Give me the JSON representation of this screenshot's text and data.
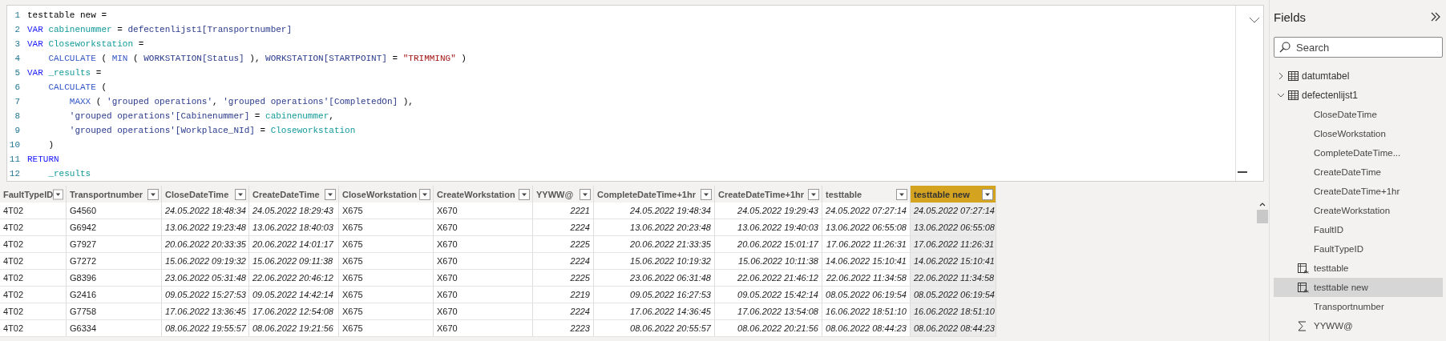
{
  "editor": {
    "lines": [
      {
        "number": "1",
        "tokens": [
          {
            "kind": "plain",
            "text": "testtable new ="
          }
        ]
      },
      {
        "number": "2",
        "tokens": [
          {
            "kind": "keyword",
            "text": "VAR "
          },
          {
            "kind": "variable",
            "text": "cabinenummer"
          },
          {
            "kind": "plain",
            "text": " = "
          },
          {
            "kind": "ref",
            "text": "defectenlijst1[Transportnumber]"
          }
        ]
      },
      {
        "number": "3",
        "tokens": [
          {
            "kind": "keyword",
            "text": "VAR "
          },
          {
            "kind": "variable",
            "text": "Closeworkstation"
          },
          {
            "kind": "plain",
            "text": " ="
          }
        ]
      },
      {
        "number": "4",
        "tokens": [
          {
            "kind": "function",
            "text": "    CALCULATE"
          },
          {
            "kind": "plain",
            "text": " ( "
          },
          {
            "kind": "function",
            "text": "MIN"
          },
          {
            "kind": "plain",
            "text": " ( "
          },
          {
            "kind": "ref",
            "text": "WORKSTATION[Status]"
          },
          {
            "kind": "plain",
            "text": " ), "
          },
          {
            "kind": "ref",
            "text": "WORKSTATION[STARTPOINT]"
          },
          {
            "kind": "plain",
            "text": " = "
          },
          {
            "kind": "string",
            "text": "\"TRIMMING\""
          },
          {
            "kind": "plain",
            "text": " )"
          }
        ]
      },
      {
        "number": "5",
        "tokens": [
          {
            "kind": "keyword",
            "text": "VAR "
          },
          {
            "kind": "variable",
            "text": "_results"
          },
          {
            "kind": "plain",
            "text": " ="
          }
        ]
      },
      {
        "number": "6",
        "tokens": [
          {
            "kind": "function",
            "text": "    CALCULATE"
          },
          {
            "kind": "plain",
            "text": " ("
          }
        ]
      },
      {
        "number": "7",
        "tokens": [
          {
            "kind": "function",
            "text": "        MAXX"
          },
          {
            "kind": "plain",
            "text": " ( "
          },
          {
            "kind": "ref",
            "text": "'grouped operations'"
          },
          {
            "kind": "plain",
            "text": ", "
          },
          {
            "kind": "ref",
            "text": "'grouped operations'[CompletedOn]"
          },
          {
            "kind": "plain",
            "text": " ),"
          }
        ]
      },
      {
        "number": "8",
        "tokens": [
          {
            "kind": "ref",
            "text": "        'grouped operations'[Cabinenummer]"
          },
          {
            "kind": "plain",
            "text": " = "
          },
          {
            "kind": "variable",
            "text": "cabinenummer"
          },
          {
            "kind": "plain",
            "text": ","
          }
        ]
      },
      {
        "number": "9",
        "tokens": [
          {
            "kind": "ref",
            "text": "        'grouped operations'[Workplace_NId]"
          },
          {
            "kind": "plain",
            "text": " = "
          },
          {
            "kind": "variable",
            "text": "Closeworkstation"
          }
        ]
      },
      {
        "number": "10",
        "tokens": [
          {
            "kind": "plain",
            "text": "    )"
          }
        ]
      },
      {
        "number": "11",
        "tokens": [
          {
            "kind": "keyword",
            "text": "RETURN"
          }
        ]
      },
      {
        "number": "12",
        "tokens": [
          {
            "kind": "variable",
            "text": "    _results"
          }
        ]
      }
    ]
  },
  "table": {
    "columns": [
      {
        "label": "FaultTypeID",
        "kind": "text",
        "selected": false
      },
      {
        "label": "Transportnumber",
        "kind": "text",
        "selected": false
      },
      {
        "label": "CloseDateTime",
        "kind": "date",
        "selected": false
      },
      {
        "label": "CreateDateTime",
        "kind": "date",
        "selected": false
      },
      {
        "label": "CloseWorkstation",
        "kind": "text",
        "selected": false
      },
      {
        "label": "CreateWorkstation",
        "kind": "text",
        "selected": false
      },
      {
        "label": "YYWW@",
        "kind": "value",
        "selected": false
      },
      {
        "label": "CompleteDateTime+1hr",
        "kind": "value",
        "selected": false
      },
      {
        "label": "CreateDateTime+1hr",
        "kind": "value",
        "selected": false
      },
      {
        "label": "testtable",
        "kind": "value",
        "selected": false
      },
      {
        "label": "testtable new",
        "kind": "value",
        "selected": true
      }
    ],
    "rows": [
      [
        "4T02",
        "G4560",
        "24.05.2022 18:48:34",
        "24.05.2022 18:29:43",
        "X675",
        "X670",
        "2221",
        "24.05.2022 19:48:34",
        "24.05.2022 19:29:43",
        "24.05.2022 07:27:14",
        "24.05.2022 07:27:14"
      ],
      [
        "4T02",
        "G6942",
        "13.06.2022 19:23:48",
        "13.06.2022 18:40:03",
        "X675",
        "X670",
        "2224",
        "13.06.2022 20:23:48",
        "13.06.2022 19:40:03",
        "13.06.2022 06:55:08",
        "13.06.2022 06:55:08"
      ],
      [
        "4T02",
        "G7927",
        "20.06.2022 20:33:35",
        "20.06.2022 14:01:17",
        "X675",
        "X670",
        "2225",
        "20.06.2022 21:33:35",
        "20.06.2022 15:01:17",
        "17.06.2022 11:26:31",
        "17.06.2022 11:26:31"
      ],
      [
        "4T02",
        "G7272",
        "15.06.2022 09:19:32",
        "15.06.2022 09:11:38",
        "X675",
        "X670",
        "2224",
        "15.06.2022 10:19:32",
        "15.06.2022 10:11:38",
        "14.06.2022 15:10:41",
        "14.06.2022 15:10:41"
      ],
      [
        "4T02",
        "G8396",
        "23.06.2022 05:31:48",
        "22.06.2022 20:46:12",
        "X675",
        "X670",
        "2225",
        "23.06.2022 06:31:48",
        "22.06.2022 21:46:12",
        "22.06.2022 11:34:58",
        "22.06.2022 11:34:58"
      ],
      [
        "4T02",
        "G2416",
        "09.05.2022 15:27:53",
        "09.05.2022 14:42:14",
        "X675",
        "X670",
        "2219",
        "09.05.2022 16:27:53",
        "09.05.2022 15:42:14",
        "08.05.2022 06:19:54",
        "08.05.2022 06:19:54"
      ],
      [
        "4T02",
        "G7758",
        "17.06.2022 13:36:45",
        "17.06.2022 12:54:08",
        "X675",
        "X670",
        "2224",
        "17.06.2022 14:36:45",
        "17.06.2022 13:54:08",
        "16.06.2022 18:51:10",
        "16.06.2022 18:51:10"
      ],
      [
        "4T02",
        "G6334",
        "08.06.2022 19:55:57",
        "08.06.2022 19:21:56",
        "X675",
        "X670",
        "2223",
        "08.06.2022 20:55:57",
        "08.06.2022 20:21:56",
        "08.06.2022 08:44:23",
        "08.06.2022 08:44:23"
      ]
    ]
  },
  "fields": {
    "title": "Fields",
    "search": {
      "placeholder": "Search"
    },
    "tables": [
      {
        "name": "datumtabel",
        "expanded": false
      },
      {
        "name": "defectenlijst1",
        "expanded": true,
        "children": [
          {
            "name": "CloseDateTime",
            "kind": "column",
            "selected": false
          },
          {
            "name": "CloseWorkstation",
            "kind": "column",
            "selected": false
          },
          {
            "name": "CompleteDateTime...",
            "kind": "column",
            "selected": false
          },
          {
            "name": "CreateDateTime",
            "kind": "column",
            "selected": false
          },
          {
            "name": "CreateDateTime+1hr",
            "kind": "column",
            "selected": false
          },
          {
            "name": "CreateWorkstation",
            "kind": "column",
            "selected": false
          },
          {
            "name": "FaultID",
            "kind": "column",
            "selected": false
          },
          {
            "name": "FaultTypeID",
            "kind": "column",
            "selected": false
          },
          {
            "name": "testtable",
            "kind": "calculated",
            "selected": false
          },
          {
            "name": "testtable new",
            "kind": "calculated",
            "selected": true
          },
          {
            "name": "Transportnumber",
            "kind": "column",
            "selected": false
          },
          {
            "name": "YYWW@",
            "kind": "sum",
            "selected": false
          }
        ]
      }
    ]
  }
}
